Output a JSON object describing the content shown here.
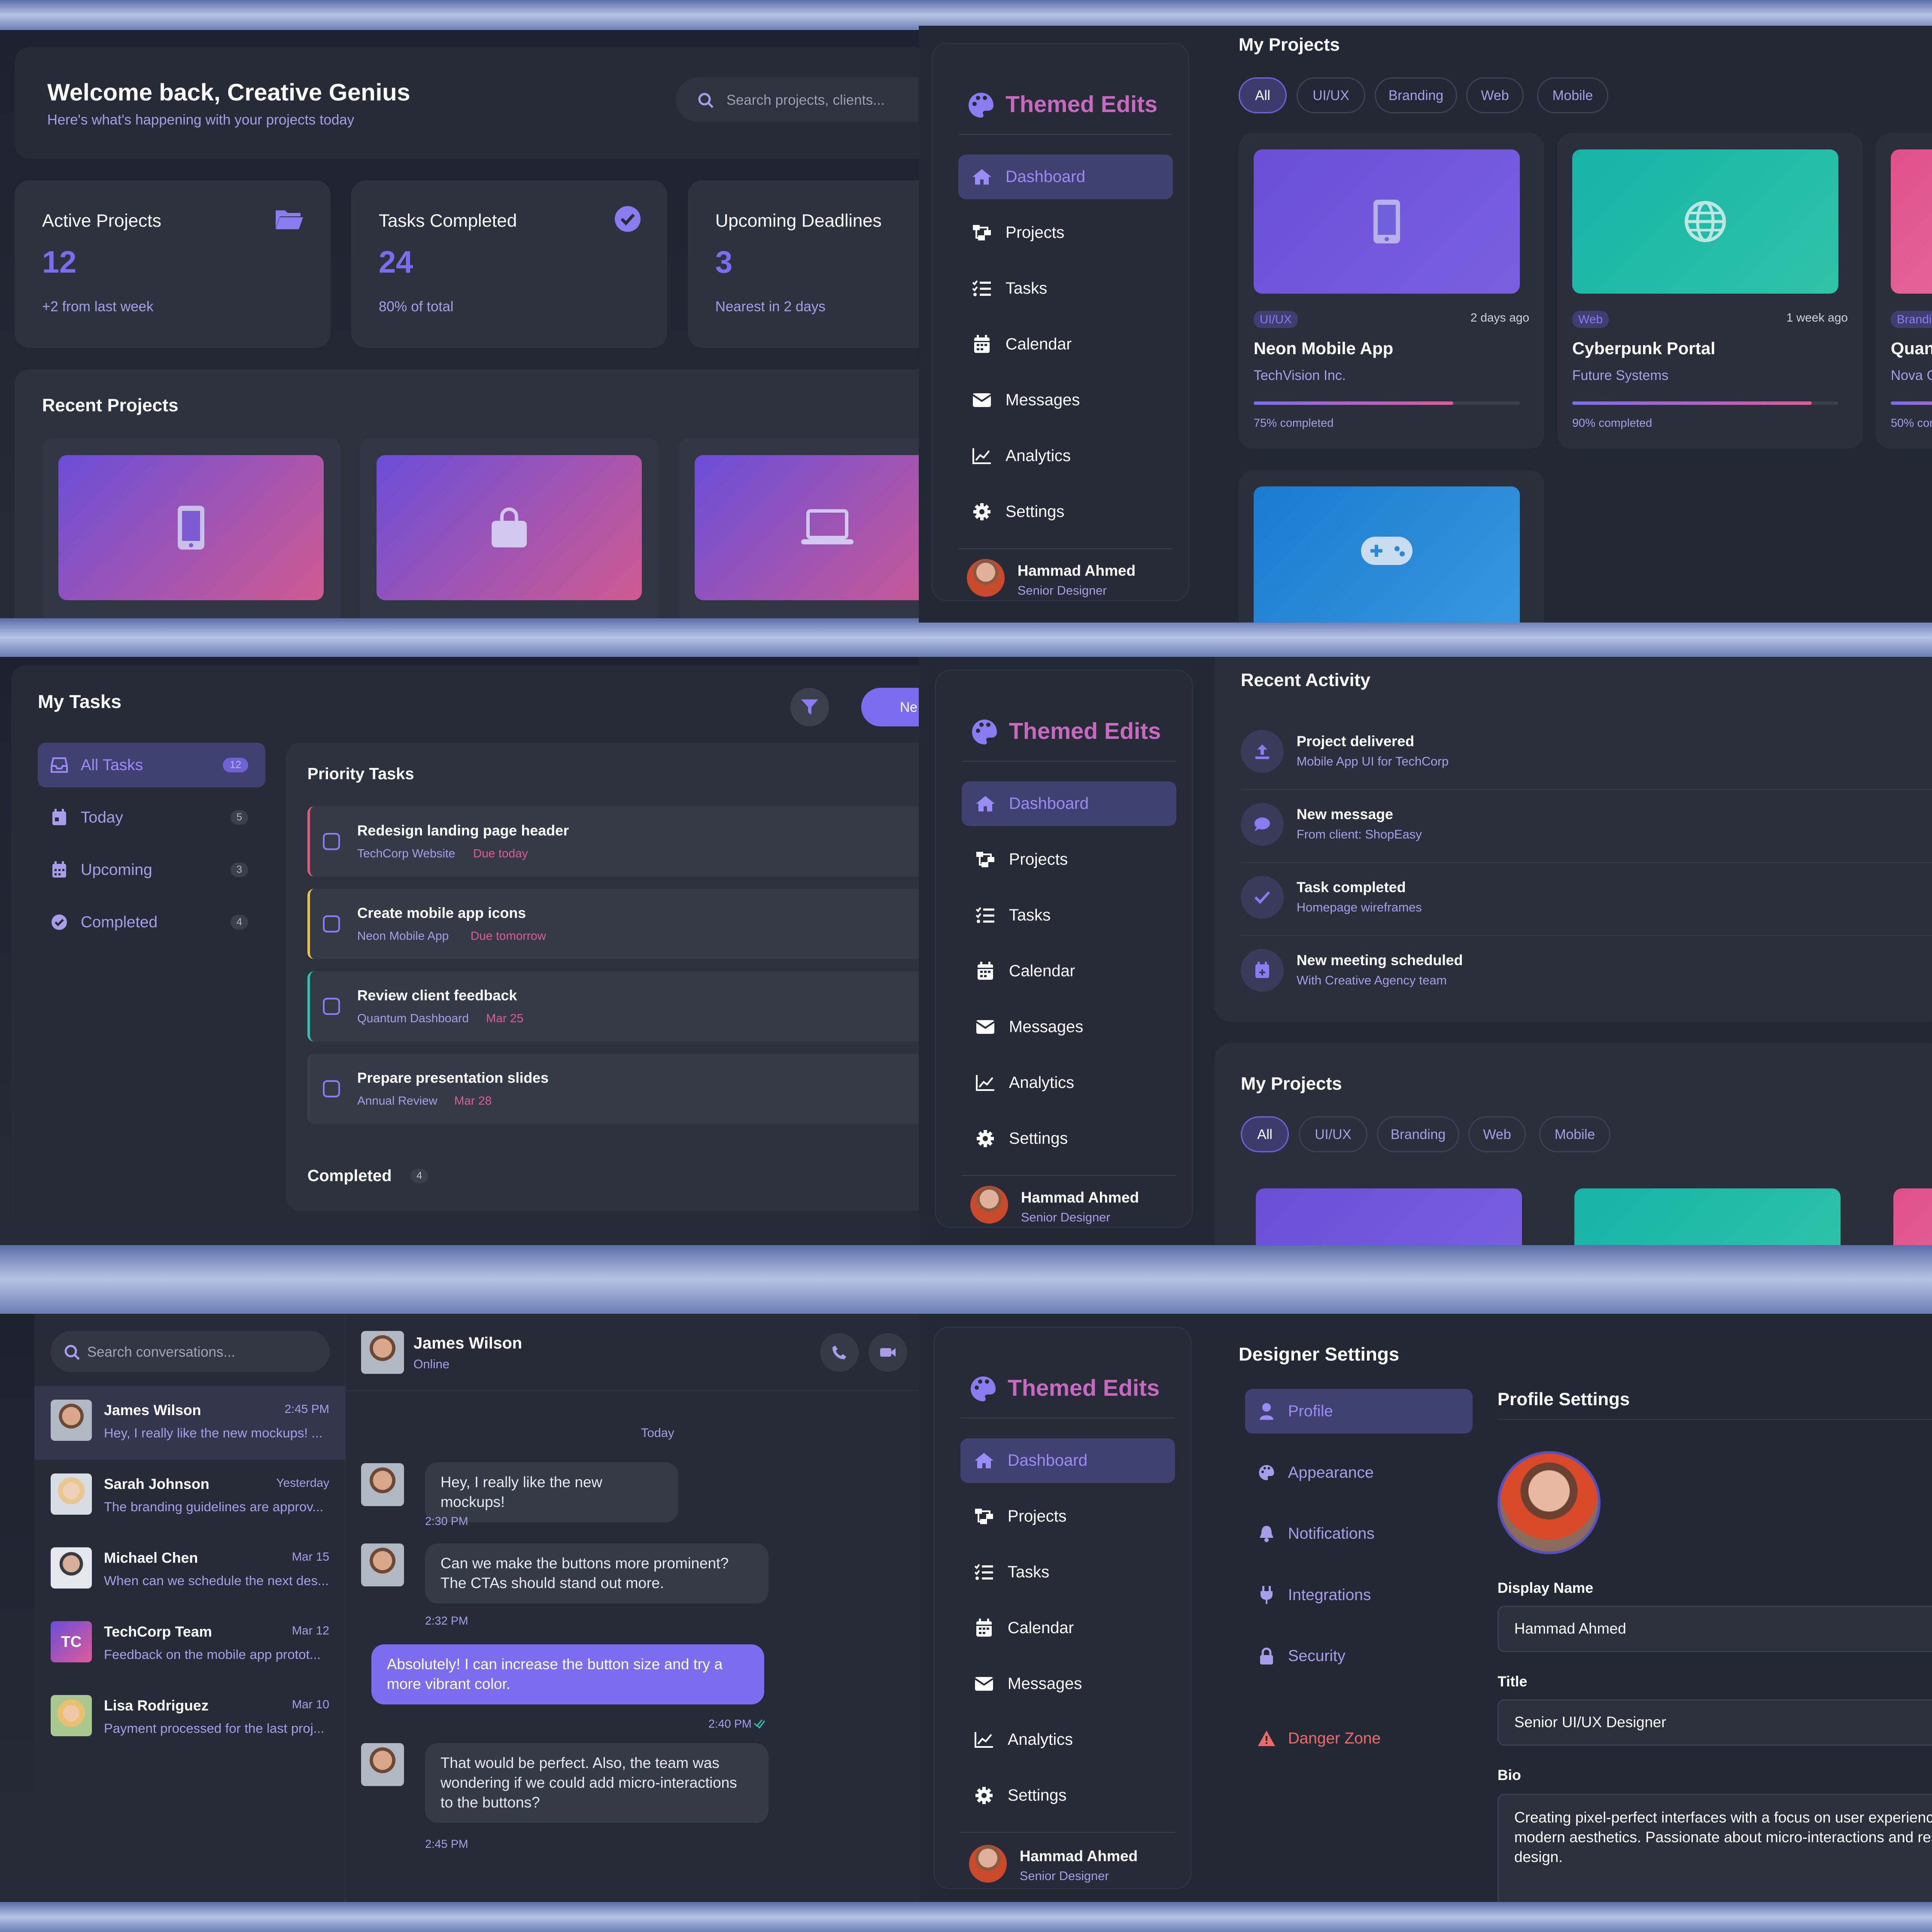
{
  "dashboard": {
    "welcome_title": "Welcome back, Creative Genius",
    "welcome_sub": "Here's what's happening with your projects today",
    "search_placeholder": "Search projects, clients...",
    "stats": [
      {
        "label": "Active Projects",
        "value": "12",
        "note": "+2 from last week"
      },
      {
        "label": "Tasks Completed",
        "value": "24",
        "note": "80% of total"
      },
      {
        "label": "Upcoming Deadlines",
        "value": "3",
        "note": "Nearest in 2 days"
      }
    ],
    "recent_projects_title": "Recent Projects"
  },
  "sidebar": {
    "brand": "Themed Edits",
    "items": [
      "Dashboard",
      "Projects",
      "Tasks",
      "Calendar",
      "Messages",
      "Analytics",
      "Settings"
    ],
    "user_name": "Hammad Ahmed",
    "user_role": "Senior Designer"
  },
  "projects": {
    "title": "My Projects",
    "filters": [
      "All",
      "UI/UX",
      "Branding",
      "Web",
      "Mobile"
    ],
    "cards": [
      {
        "tag": "UI/UX",
        "time": "2 days ago",
        "name": "Neon Mobile App",
        "client": "TechVision Inc.",
        "progress_label": "75% completed",
        "progress": 0.75
      },
      {
        "tag": "Web",
        "time": "1 week ago",
        "name": "Cyberpunk Portal",
        "client": "Future Systems",
        "progress_label": "90% completed",
        "progress": 0.9
      },
      {
        "tag": "Brandi",
        "name": "Quan",
        "client": "Nova C",
        "progress_label": "50% com",
        "progress": 0.5
      }
    ]
  },
  "tasks": {
    "title": "My Tasks",
    "new_btn": "Ne",
    "filters": [
      {
        "label": "All Tasks",
        "count": "12"
      },
      {
        "label": "Today",
        "count": "5"
      },
      {
        "label": "Upcoming",
        "count": "3"
      },
      {
        "label": "Completed",
        "count": "4"
      }
    ],
    "priority_title": "Priority Tasks",
    "items": [
      {
        "title": "Redesign landing page header",
        "project": "TechCorp Website",
        "due": "Due today",
        "color": "#e05a7a"
      },
      {
        "title": "Create mobile app icons",
        "project": "Neon Mobile App",
        "due": "Due tomorrow",
        "color": "#e8c24a"
      },
      {
        "title": "Review client feedback",
        "project": "Quantum Dashboard",
        "due": "Mar 25",
        "color": "#2fc3a8"
      },
      {
        "title": "Prepare presentation slides",
        "project": "Annual Review",
        "due": "Mar 28",
        "color": "#3a3f4c"
      }
    ],
    "completed_label": "Completed",
    "completed_count": "4"
  },
  "activity": {
    "title": "Recent Activity",
    "items": [
      {
        "title": "Project delivered",
        "sub": "Mobile App UI for TechCorp"
      },
      {
        "title": "New message",
        "sub": "From client: ShopEasy"
      },
      {
        "title": "Task completed",
        "sub": "Homepage wireframes"
      },
      {
        "title": "New meeting scheduled",
        "sub": "With Creative Agency team"
      }
    ]
  },
  "messages": {
    "search_placeholder": "Search conversations...",
    "conversations": [
      {
        "name": "James Wilson",
        "time": "2:45 PM",
        "preview": "Hey, I really like the new mockups! ..."
      },
      {
        "name": "Sarah Johnson",
        "time": "Yesterday",
        "preview": "The branding guidelines are approv..."
      },
      {
        "name": "Michael Chen",
        "time": "Mar 15",
        "preview": "When can we schedule the next des..."
      },
      {
        "name": "TechCorp Team",
        "time": "Mar 12",
        "preview": "Feedback on the mobile app protot...",
        "initials": "TC"
      },
      {
        "name": "Lisa Rodriguez",
        "time": "Mar 10",
        "preview": "Payment processed for the last proj..."
      }
    ],
    "chat_name": "James Wilson",
    "chat_status": "Online",
    "day_label": "Today",
    "thread": [
      {
        "text": "Hey, I really like the new mockups!",
        "time": "2:30 PM",
        "mine": false
      },
      {
        "text": "Can we make the buttons more prominent? The CTAs should stand out more.",
        "time": "2:32 PM",
        "mine": false
      },
      {
        "text": "Absolutely! I can increase the button size and try a more vibrant color.",
        "time": "2:40 PM",
        "mine": true
      },
      {
        "text": "That would be perfect. Also, the team was wondering if we could add micro-interactions to the buttons?",
        "time": "2:45 PM",
        "mine": false
      }
    ]
  },
  "settings": {
    "title": "Designer Settings",
    "menu": [
      "Profile",
      "Appearance",
      "Notifications",
      "Integrations",
      "Security",
      "Danger Zone"
    ],
    "profile_title": "Profile Settings",
    "display_name_label": "Display Name",
    "display_name": "Hammad Ahmed",
    "title_label": "Title",
    "title_value": "Senior UI/UX Designer",
    "bio_label": "Bio",
    "bio": "Creating pixel-perfect interfaces with a focus on user experience a modern aesthetics. Passionate about micro-interactions and resp design."
  },
  "colors": {
    "accent": "#7b6cf0",
    "pink": "#e05a9a",
    "teal": "#2fc3a8",
    "danger": "#f06a6a"
  }
}
